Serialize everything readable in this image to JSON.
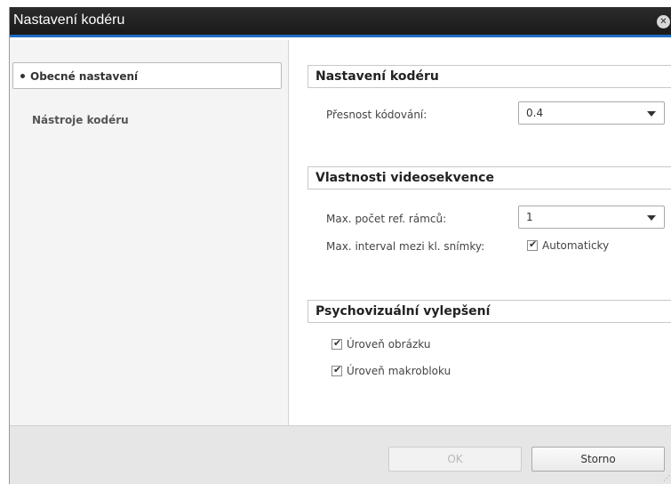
{
  "window": {
    "title": "Nastavení kodéru",
    "close_glyph": "✕"
  },
  "sidebar": {
    "items": [
      {
        "label": "Obecné nastavení",
        "active": true
      },
      {
        "label": "Nástroje kodéru",
        "active": false
      }
    ]
  },
  "sections": {
    "encoder": {
      "header": "Nastavení kodéru",
      "precision_label": "Přesnost kódování:",
      "precision_value": "0.4"
    },
    "video": {
      "header": "Vlastnosti videosekvence",
      "refframes_label": "Max. počet ref. rámců:",
      "refframes_value": "1",
      "keyint_label": "Max. interval mezi kl. snímky:",
      "keyint_checkbox_label": "Automaticky",
      "keyint_checked": true
    },
    "psycho": {
      "header": "Psychovizuální vylepšení",
      "picture_label": "Úroveň obrázku",
      "picture_checked": true,
      "macroblock_label": "Úroveň makrobloku",
      "macroblock_checked": true
    }
  },
  "footer": {
    "ok_label": "OK",
    "cancel_label": "Storno",
    "grip_glyph": "⋰"
  },
  "colors": {
    "title_bg": "#1a1a1a",
    "accent": "#1f6cc4",
    "sidebar_bg": "#f4f4f4",
    "footer_bg": "#e6e6e6"
  },
  "icons": {
    "close": "close-icon",
    "dropdown": "chevron-down-icon",
    "check": "checkmark-icon",
    "bullet": "bullet-icon",
    "resize": "resize-grip-icon"
  }
}
